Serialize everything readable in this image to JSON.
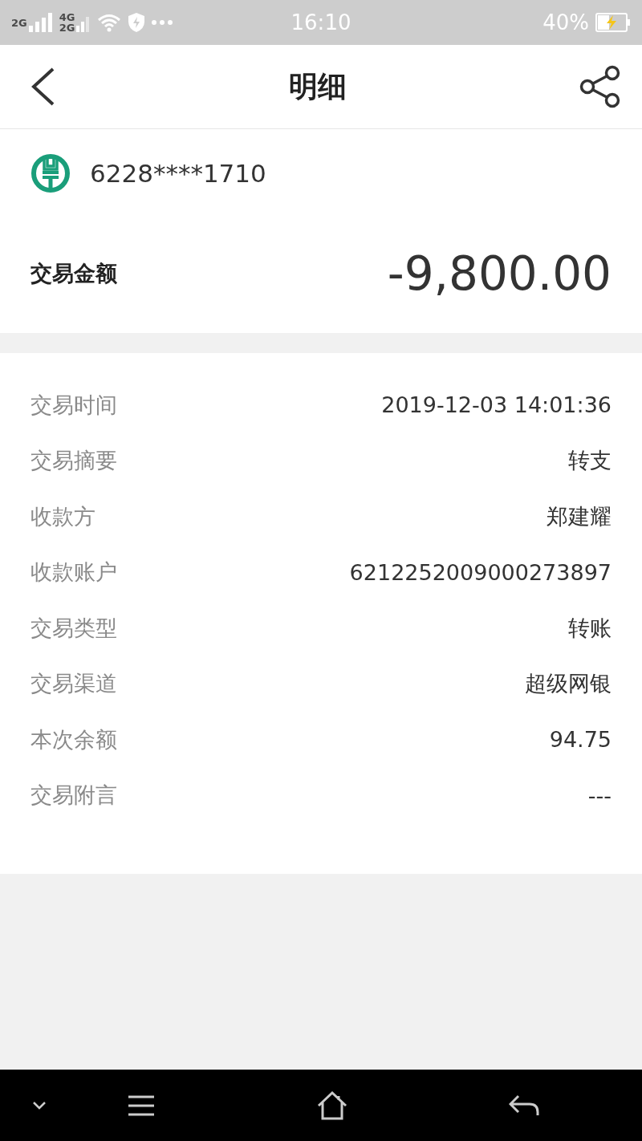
{
  "status_bar": {
    "network_labels": [
      "2G",
      "4G",
      "2G"
    ],
    "time": "16:10",
    "battery": "40%",
    "charging": true
  },
  "header": {
    "title": "明细"
  },
  "account": {
    "card_number": "6228****1710"
  },
  "amount": {
    "label": "交易金额",
    "value": "-9,800.00"
  },
  "details": [
    {
      "label": "交易时间",
      "value": "2019-12-03 14:01:36"
    },
    {
      "label": "交易摘要",
      "value": "转支"
    },
    {
      "label": "收款方",
      "value": "郑建耀"
    },
    {
      "label": "收款账户",
      "value": "6212252009000273897"
    },
    {
      "label": "交易类型",
      "value": "转账"
    },
    {
      "label": "交易渠道",
      "value": "超级网银"
    },
    {
      "label": "本次余额",
      "value": "94.75"
    },
    {
      "label": "交易附言",
      "value": "---"
    }
  ]
}
